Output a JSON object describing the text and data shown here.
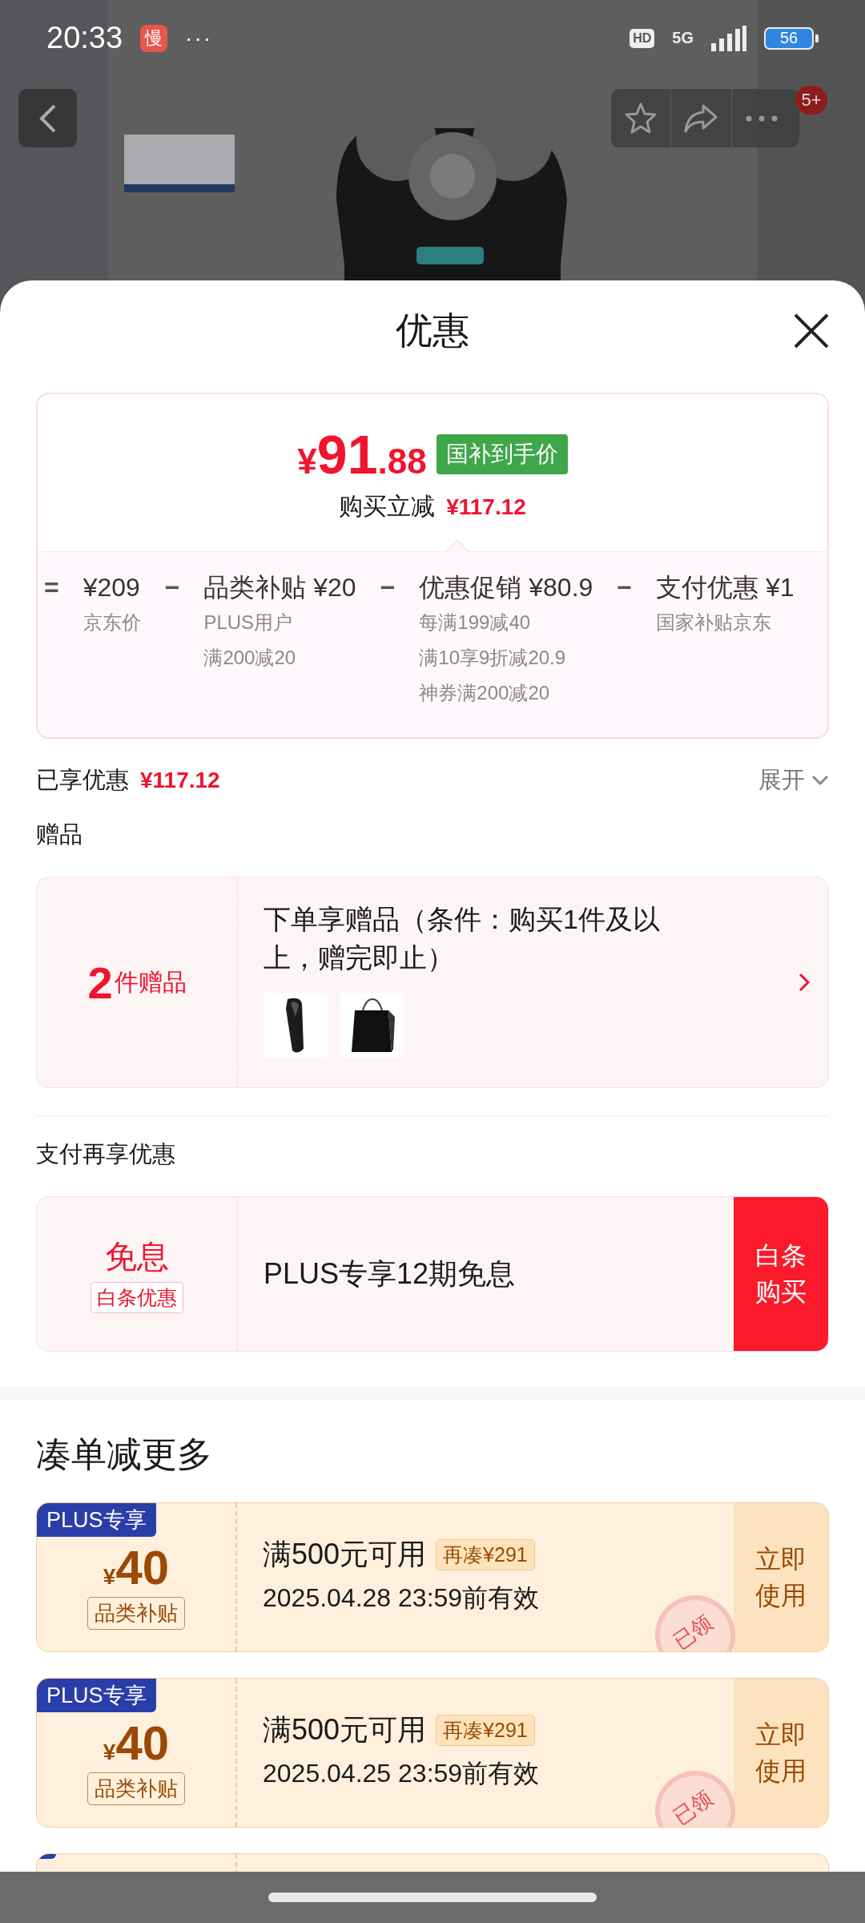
{
  "status_bar": {
    "time": "20:33",
    "app_badge": "慢",
    "more": "···",
    "hd": "HD",
    "network": "5G",
    "battery": "56"
  },
  "header": {
    "message_count": "5+"
  },
  "sheet": {
    "title": "优惠"
  },
  "price_card": {
    "price_symbol": "¥",
    "price_integer": "91",
    "price_decimal": ".88",
    "price_tag": "国补到手价",
    "saving_label": "购买立减",
    "saving_amount": "¥117.12",
    "breakdown": [
      {
        "kind": "op",
        "text": "="
      },
      {
        "kind": "term",
        "title": "¥209",
        "notes": [
          "京东价"
        ]
      },
      {
        "kind": "op",
        "text": "−"
      },
      {
        "kind": "term",
        "title": "品类补贴 ¥20",
        "notes": [
          "PLUS用户",
          "满200减20"
        ]
      },
      {
        "kind": "op",
        "text": "−"
      },
      {
        "kind": "term",
        "title": "优惠促销 ¥80.9",
        "notes": [
          "每满199减40",
          "满10享9折减20.9",
          "神券满200减20"
        ]
      },
      {
        "kind": "op",
        "text": "−"
      },
      {
        "kind": "term",
        "title": "支付优惠 ¥1",
        "notes": [
          "国家补贴京东"
        ]
      }
    ]
  },
  "enjoyed": {
    "label": "已享优惠",
    "amount": "¥117.12",
    "expand": "展开"
  },
  "gifts": {
    "heading": "赠品",
    "count": "2",
    "count_label": "件赠品",
    "description": "下单享赠品（条件：购买1件及以上，赠完即止）"
  },
  "payment": {
    "heading": "支付再享优惠",
    "title": "免息",
    "tag": "白条优惠",
    "offer": "PLUS专享12期免息",
    "button": "白条购买"
  },
  "bundle": {
    "heading": "凑单减更多",
    "coupons": [
      {
        "badge": "PLUS专享",
        "currency": "¥",
        "amount": "40",
        "tag": "品类补贴",
        "condition": "满500元可用",
        "top_up": "再凑¥291",
        "validity": "2025.04.28 23:59前有效",
        "action": "立即使用",
        "stamp": "已领"
      },
      {
        "badge": "PLUS专享",
        "currency": "¥",
        "amount": "40",
        "tag": "品类补贴",
        "condition": "满500元可用",
        "top_up": "再凑¥291",
        "validity": "2025.04.25 23:59前有效",
        "action": "立即使用",
        "stamp": "已领"
      }
    ],
    "more_below": true
  }
}
